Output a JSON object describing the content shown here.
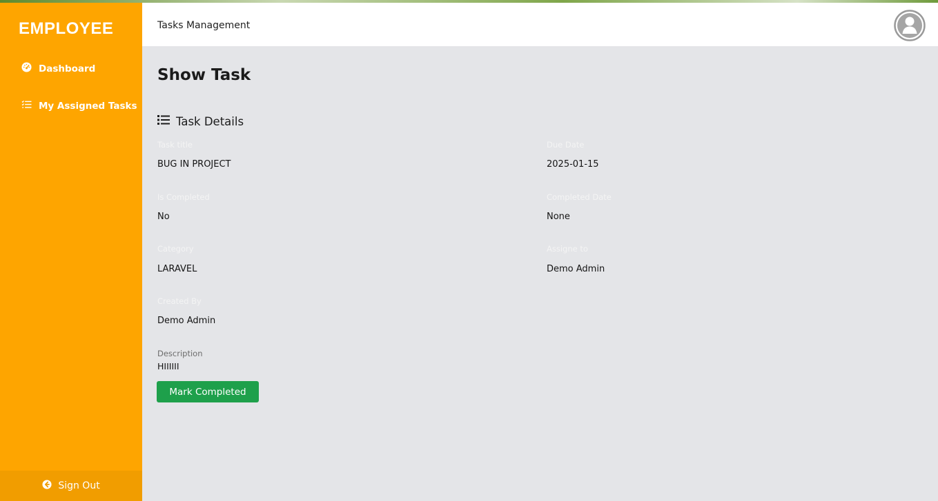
{
  "sidebar": {
    "brand": "EMPLOYEE",
    "items": [
      {
        "label": "Dashboard",
        "icon": "dashboard-gauge-icon"
      },
      {
        "label": "My Assigned Tasks",
        "icon": "task-list-icon"
      }
    ],
    "signout_label": "Sign Out",
    "signout_icon": "arrow-circle-left-icon",
    "background_color": "#fea500"
  },
  "header": {
    "title": "Tasks Management",
    "avatar_icon": "user-avatar-icon"
  },
  "page": {
    "title": "Show Task",
    "section_title": "Task Details",
    "section_icon": "list-icon"
  },
  "task": {
    "title_label": "Task title",
    "title_value": "BUG IN PROJECT",
    "due_label": "Due Date",
    "due_value": "2025-01-15",
    "completed_label": "Is Completed",
    "completed_value": "No",
    "completed_date_label": "Completed Date",
    "completed_date_value": "None",
    "category_label": "Category",
    "category_value": "LARAVEL",
    "assigned_label": "Assigne to",
    "assigned_value": "Demo Admin",
    "created_label": "Created By",
    "created_value": "Demo Admin",
    "description_label": "Description",
    "description_value": "HIIIIII"
  },
  "actions": {
    "mark_completed": "Mark Completed",
    "button_color": "#1ea04b"
  }
}
